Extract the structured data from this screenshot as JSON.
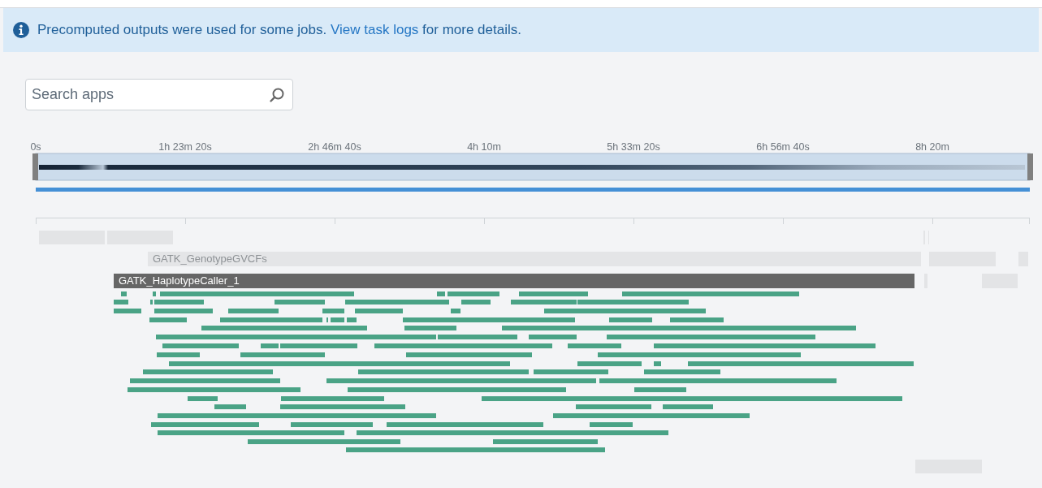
{
  "banner": {
    "text_before": "Precomputed outputs were used for some jobs.",
    "link": "View task logs",
    "text_after": "for more details."
  },
  "search": {
    "placeholder": "Search apps"
  },
  "axis": {
    "ticks": [
      "0s",
      "1h 23m 20s",
      "2h 46m 40s",
      "4h 10m",
      "5h 33m 20s",
      "6h 56m 40s",
      "8h 20m"
    ]
  },
  "jobs": [
    {
      "label": "GATK_GenotypeGVCFs",
      "kind": "light"
    },
    {
      "label": "GATK_HaplotypeCaller_1",
      "kind": "dark"
    }
  ]
}
